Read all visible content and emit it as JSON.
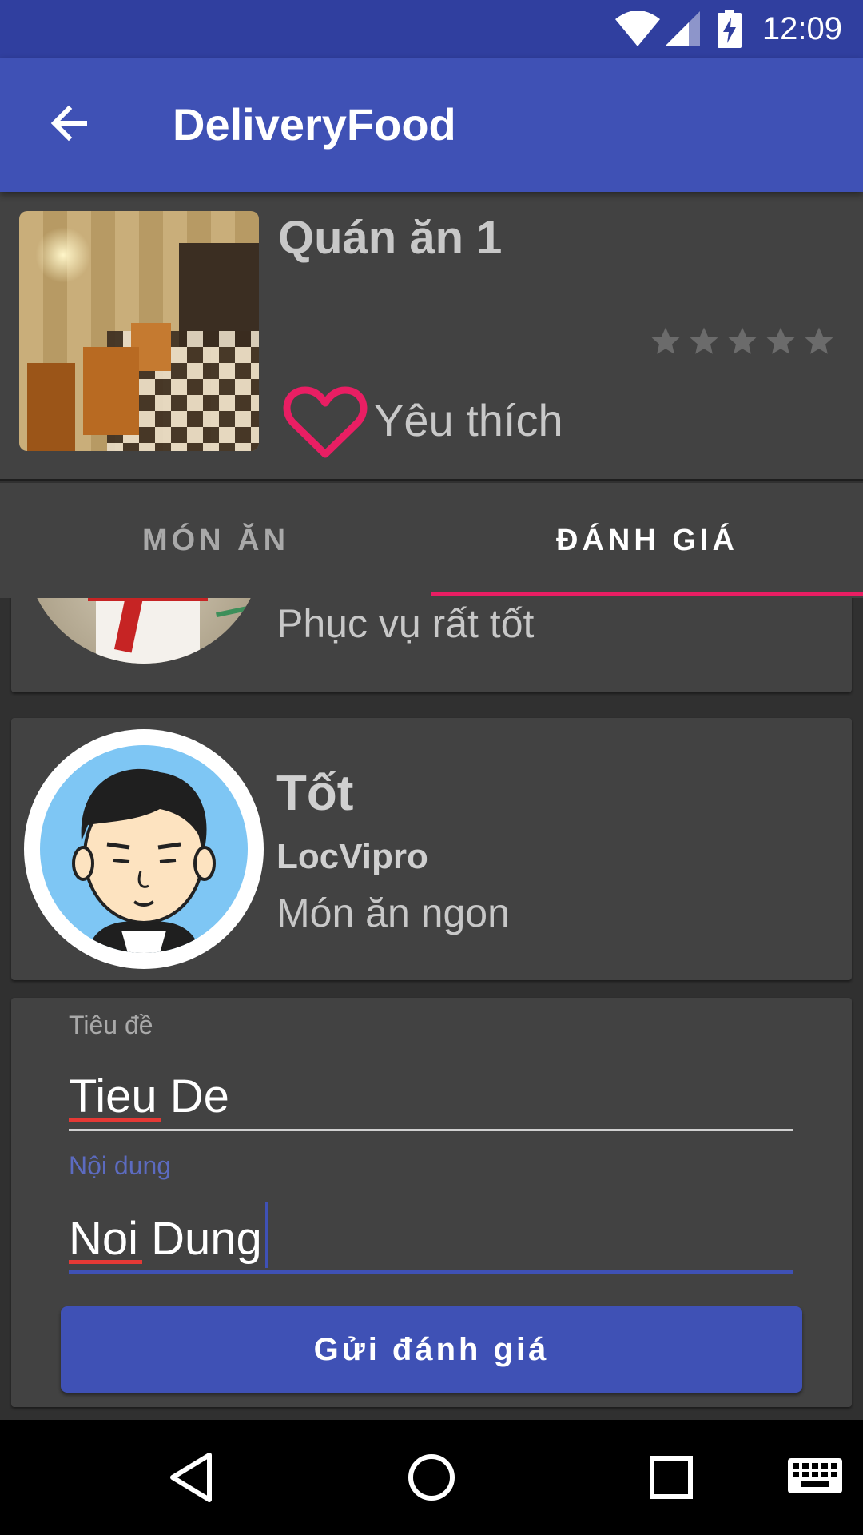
{
  "status_bar": {
    "time": "12:09",
    "icons": [
      "wifi-icon",
      "signal-icon",
      "battery-charging-icon"
    ]
  },
  "app_bar": {
    "title": "DeliveryFood",
    "back_icon": "arrow-back-icon"
  },
  "restaurant": {
    "name": "Quán ăn 1",
    "rating_stars": 5,
    "rating_filled": 0,
    "favorite_label": "Yêu thích",
    "favorite_icon": "heart-outline-icon"
  },
  "tabs": [
    {
      "label": "MÓN ĂN",
      "selected": false
    },
    {
      "label": "ĐÁNH GIÁ",
      "selected": true
    }
  ],
  "reviews": [
    {
      "title": "",
      "author": "",
      "content": "Phục vụ rất tốt"
    },
    {
      "title": "Tốt",
      "author": "LocVipro",
      "content": "Món ăn ngon"
    }
  ],
  "form": {
    "title_label": "Tiêu đề",
    "title_value": "Tieu De",
    "content_label": "Nội dung",
    "content_value": "Noi Dung",
    "submit_label": "Gửi đánh giá"
  },
  "colors": {
    "primary": "#3F51B5",
    "primary_dark": "#303F9F",
    "accent": "#E91E63",
    "card": "#424242",
    "background": "#303030"
  },
  "nav_bar": {
    "icons": [
      "back-triangle-icon",
      "home-circle-icon",
      "recents-square-icon",
      "keyboard-icon"
    ]
  }
}
